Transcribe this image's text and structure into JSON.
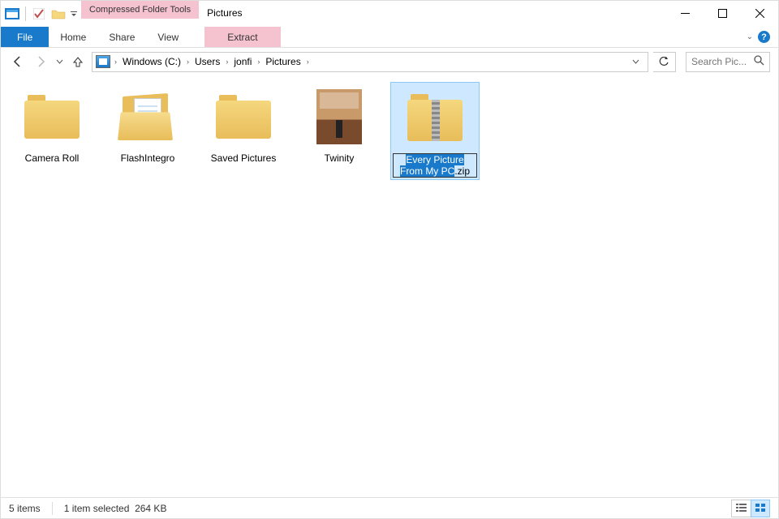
{
  "window": {
    "title": "Pictures",
    "context_tool": "Compressed Folder Tools"
  },
  "ribbon": {
    "file": "File",
    "home": "Home",
    "share": "Share",
    "view": "View",
    "extract": "Extract"
  },
  "breadcrumb": {
    "items": [
      "Windows (C:)",
      "Users",
      "jonfi",
      "Pictures"
    ]
  },
  "search": {
    "placeholder": "Search Pic..."
  },
  "items": [
    {
      "name": "Camera Roll",
      "type": "folder-closed"
    },
    {
      "name": "FlashIntegro",
      "type": "folder-open"
    },
    {
      "name": "Saved Pictures",
      "type": "folder-closed"
    },
    {
      "name": "Twinity",
      "type": "image"
    },
    {
      "name_editable": "Every Picture From My PC",
      "ext": ".zip",
      "type": "zip",
      "selected": true,
      "renaming": true
    }
  ],
  "status": {
    "count": "5 items",
    "selection": "1 item selected",
    "size": "264 KB"
  }
}
